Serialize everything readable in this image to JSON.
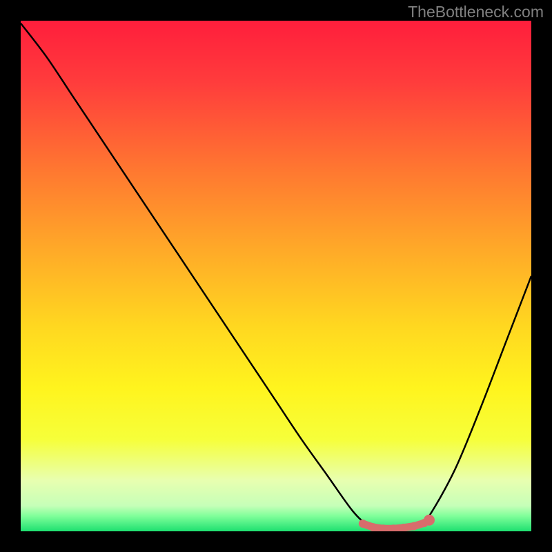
{
  "watermark": "TheBottleneck.com",
  "chart_data": {
    "type": "line",
    "title": "",
    "xlabel": "",
    "ylabel": "",
    "xlim": [
      0,
      1
    ],
    "ylim": [
      0,
      1
    ],
    "x": [
      0.0,
      0.05,
      0.1,
      0.15,
      0.2,
      0.25,
      0.3,
      0.35,
      0.4,
      0.45,
      0.5,
      0.55,
      0.6,
      0.65,
      0.68,
      0.7,
      0.72,
      0.74,
      0.76,
      0.78,
      0.8,
      0.85,
      0.9,
      0.95,
      1.0
    ],
    "values": [
      0.995,
      0.93,
      0.855,
      0.78,
      0.705,
      0.63,
      0.555,
      0.48,
      0.405,
      0.33,
      0.255,
      0.18,
      0.11,
      0.04,
      0.012,
      0.005,
      0.003,
      0.003,
      0.005,
      0.012,
      0.03,
      0.12,
      0.24,
      0.37,
      0.5
    ],
    "gradient_stops": [
      {
        "offset": 0.0,
        "color": "#ff1e3c"
      },
      {
        "offset": 0.12,
        "color": "#ff3c3c"
      },
      {
        "offset": 0.3,
        "color": "#ff7a30"
      },
      {
        "offset": 0.45,
        "color": "#ffaa28"
      },
      {
        "offset": 0.6,
        "color": "#ffd820"
      },
      {
        "offset": 0.72,
        "color": "#fff41e"
      },
      {
        "offset": 0.82,
        "color": "#f6ff3a"
      },
      {
        "offset": 0.9,
        "color": "#e8ffb0"
      },
      {
        "offset": 0.95,
        "color": "#c6ffb8"
      },
      {
        "offset": 0.97,
        "color": "#80ff9a"
      },
      {
        "offset": 1.0,
        "color": "#1ee070"
      }
    ],
    "highlight": {
      "color": "#d86c6c",
      "points": [
        {
          "x": 0.67,
          "y": 0.015
        },
        {
          "x": 0.69,
          "y": 0.008
        },
        {
          "x": 0.71,
          "y": 0.005
        },
        {
          "x": 0.73,
          "y": 0.005
        },
        {
          "x": 0.75,
          "y": 0.007
        },
        {
          "x": 0.77,
          "y": 0.01
        },
        {
          "x": 0.79,
          "y": 0.016
        }
      ],
      "end_marker": {
        "x": 0.8,
        "y": 0.022
      }
    }
  }
}
